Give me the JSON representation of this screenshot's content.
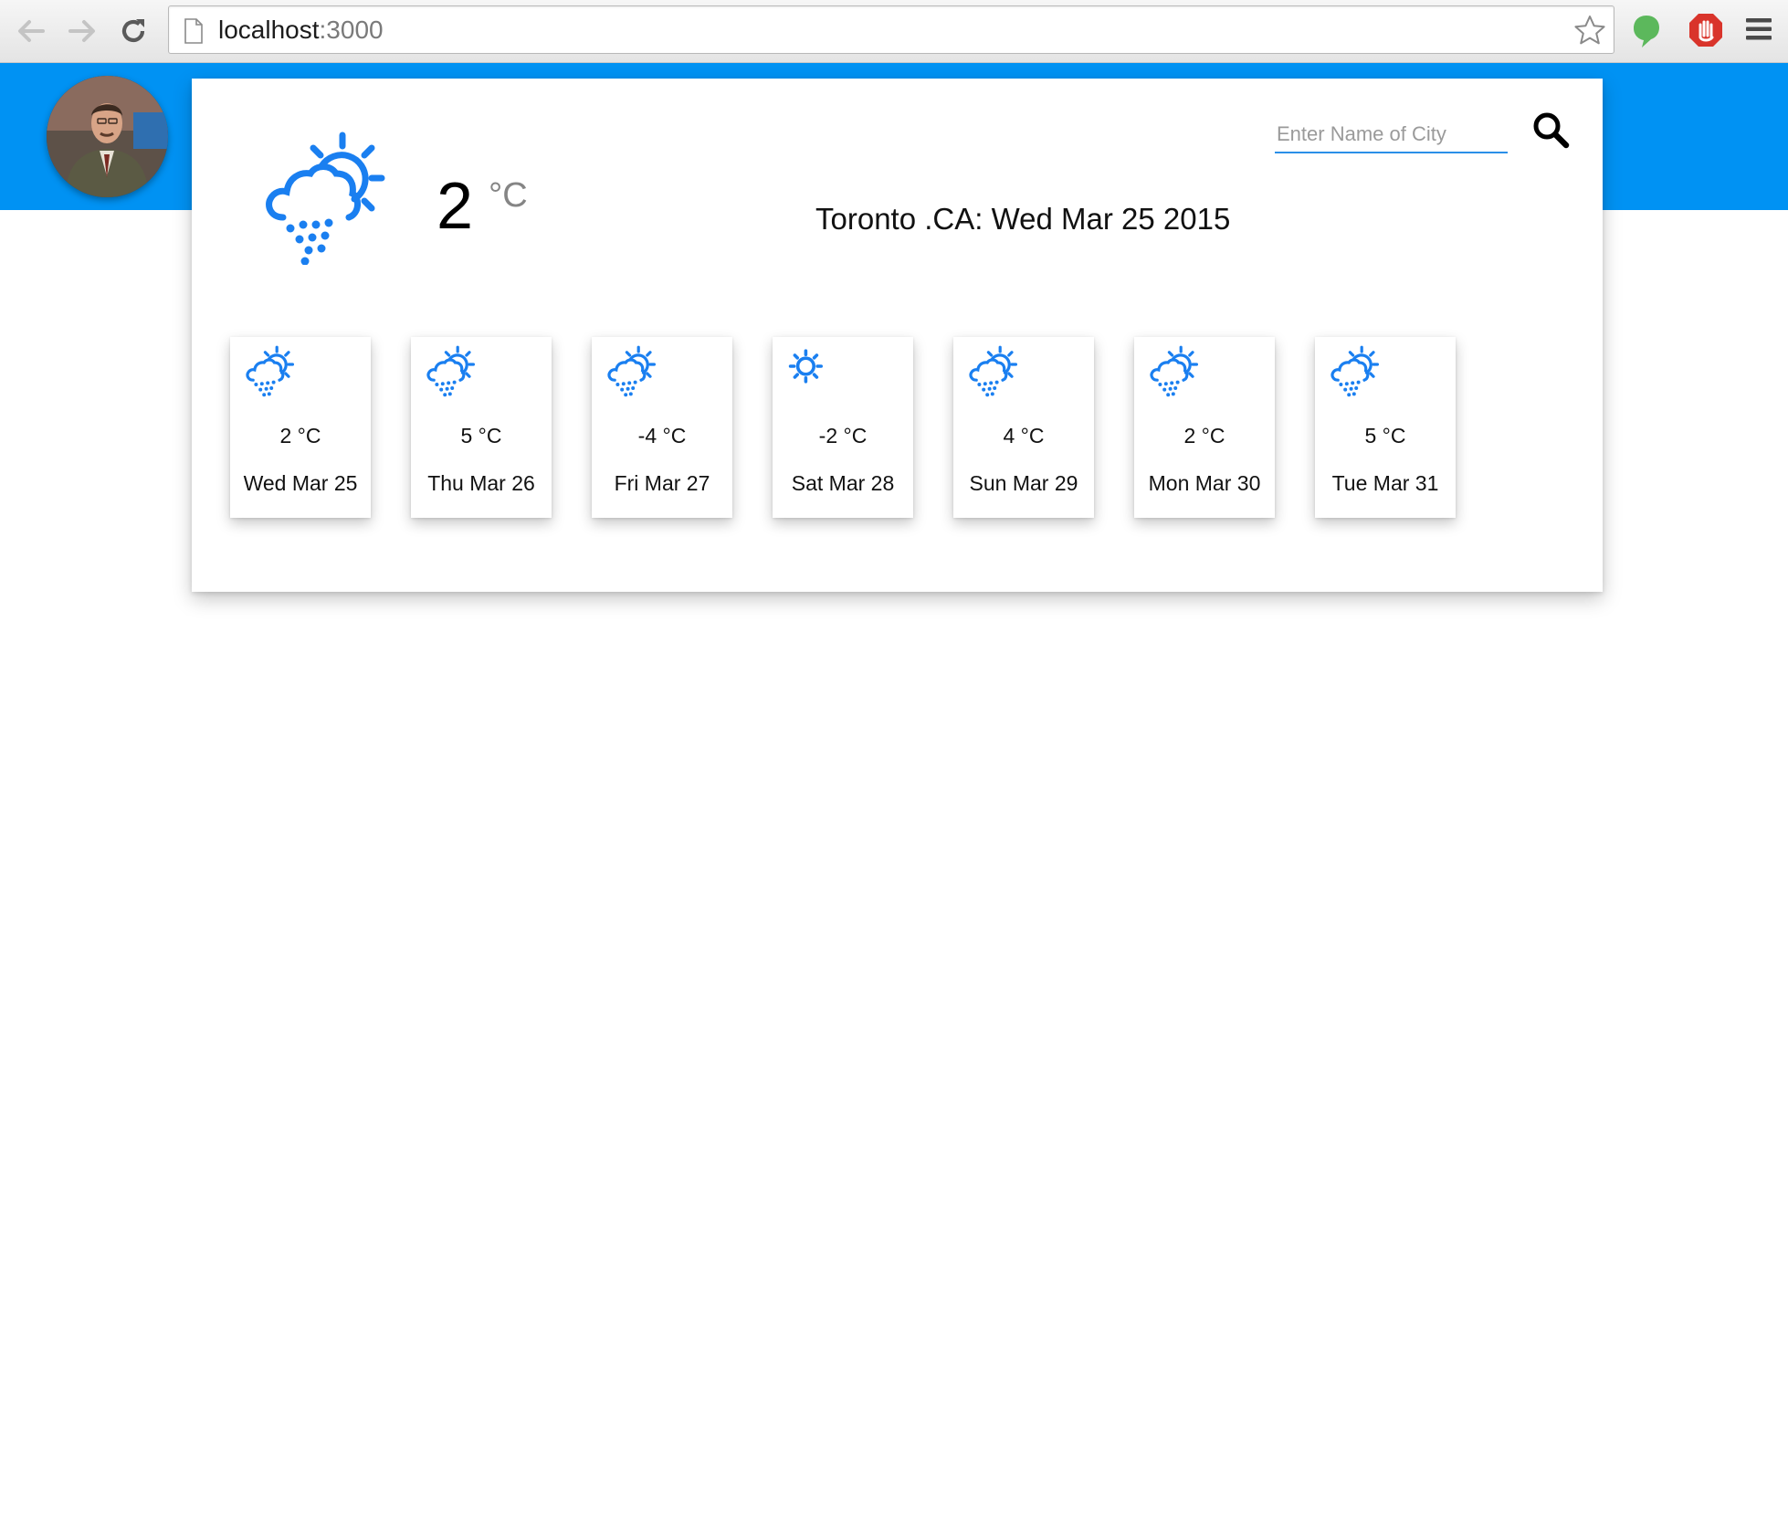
{
  "browser": {
    "url_host": "localhost",
    "url_port": ":3000",
    "icons": [
      "back-arrow-icon",
      "forward-arrow-icon",
      "reload-icon",
      "page-icon",
      "star-icon",
      "chat-bubble-icon",
      "stop-hand-icon",
      "menu-icon"
    ]
  },
  "colors": {
    "header": "#0092f3",
    "weather_icon": "#1a7ff0",
    "input_underline": "#2a8fe8"
  },
  "current": {
    "temp": "2",
    "unit": "°C",
    "location_date": "Toronto .CA: Wed Mar 25 2015",
    "icon": "cloud-sun-rain-icon"
  },
  "search": {
    "placeholder": "Enter Name of City",
    "value": "",
    "icon": "search-icon"
  },
  "forecast": [
    {
      "temp": "2 °C",
      "date": "Wed Mar 25",
      "icon": "cloud-sun-rain-icon"
    },
    {
      "temp": "5 °C",
      "date": "Thu Mar 26",
      "icon": "cloud-sun-rain-icon"
    },
    {
      "temp": "-4 °C",
      "date": "Fri Mar 27",
      "icon": "cloud-sun-rain-icon"
    },
    {
      "temp": "-2 °C",
      "date": "Sat Mar 28",
      "icon": "sun-icon"
    },
    {
      "temp": "4 °C",
      "date": "Sun Mar 29",
      "icon": "cloud-sun-rain-icon"
    },
    {
      "temp": "2 °C",
      "date": "Mon Mar 30",
      "icon": "cloud-sun-rain-icon"
    },
    {
      "temp": "5 °C",
      "date": "Tue Mar 31",
      "icon": "cloud-sun-rain-icon"
    }
  ]
}
